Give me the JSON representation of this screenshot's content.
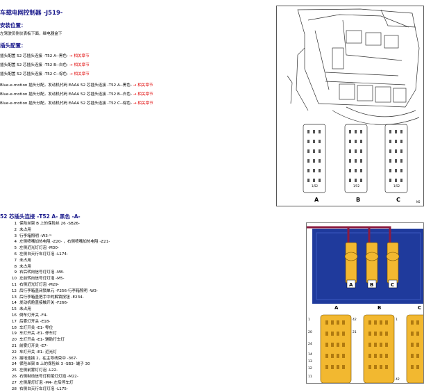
{
  "title": "车载电网控制器 -J519-",
  "install": {
    "heading": "安装位置：",
    "text": "左驾驶员侧仪表板下面，继电器盒下"
  },
  "plug": {
    "heading": "插头配置：",
    "rows": [
      {
        "text": "插头配置 52 芯插头连接 -T52 A--黑色-",
        "link": "→ 相关章节"
      },
      {
        "text": "插头配置 52 芯插头连接 -T52 B--白色-",
        "link": "→ 相关章节"
      },
      {
        "text": "插头配置 52 芯插头连接 -T52 C--棕色-",
        "link": "→ 相关章节"
      },
      {
        "text": "Blue-e-motion 插头分配，发动机代码 EAAA 52 芯插头连接 -T52 A--黑色-",
        "link": "→ 相关章节"
      },
      {
        "text": "Blue-e-motion 插头分配，发动机代码 EAAA 52 芯插头连接 -T52 B--白色-",
        "link": "→ 相关章节"
      },
      {
        "text": "Blue-e-motion 插头分配，发动机代码 EAAA 52 芯插头连接 -T52 C--棕色-",
        "link": "→ 相关章节"
      }
    ]
  },
  "section2": {
    "heading": "52 芯插头连接 -T52 A- 黑色 -A-",
    "pins": [
      {
        "num": "1",
        "text": "保险丝架 B 上的保险丝 26 -SB26-"
      },
      {
        "num": "2",
        "text": "未占用"
      },
      {
        "num": "3",
        "text": "行李箱照明 -W3-¹⁾"
      },
      {
        "num": "4",
        "text": "左侧喷嘴加热电阻 -Z20- ，右侧喷嘴加热电阻 -Z21-"
      },
      {
        "num": "5",
        "text": "左侧近光灯灯泡 -M30-"
      },
      {
        "num": "6",
        "text": "左侧白天行车灯灯泡 -L174-"
      },
      {
        "num": "7",
        "text": "未占用"
      },
      {
        "num": "8",
        "text": "未占用"
      },
      {
        "num": "9",
        "text": "右后转向信号灯灯泡 -M8-"
      },
      {
        "num": "10",
        "text": "左前转向信号灯灯泡 -M5-"
      },
      {
        "num": "11",
        "text": "右侧近光灯灯泡 -M29-"
      },
      {
        "num": "12",
        "text": "后行李箱盖闭锁单元 -F256-行李箱照明 -W3-"
      },
      {
        "num": "13",
        "text": "后行李箱盖把手中的解锁按钮 -E234-"
      },
      {
        "num": "14",
        "text": "发动机舱盖接触开关 -F266-"
      },
      {
        "num": "15",
        "text": "未占用"
      },
      {
        "num": "16",
        "text": "倒车灯开关 -F4-"
      },
      {
        "num": "17",
        "text": "后雾灯开关 -E18-"
      },
      {
        "num": "18",
        "text": "车灯开关 -E1- 零位"
      },
      {
        "num": "19",
        "text": "车灯开关 -E1- 停车灯"
      },
      {
        "num": "20",
        "text": "车灯开关 -E1- 辅助行车灯"
      },
      {
        "num": "21",
        "text": "前雾灯开关 -E7-"
      },
      {
        "num": "22",
        "text": "车灯开关 -E1- 近光灯"
      },
      {
        "num": "23",
        "text": "接地连接 2，在主导线束中 -367-"
      },
      {
        "num": "24",
        "text": "保险丝架 B 上的保险丝 3 -SB3- 端子 30"
      },
      {
        "num": "25",
        "text": "左侧前雾灯灯泡 -L22-"
      },
      {
        "num": "26",
        "text": "右侧制动信号灯和尾灯灯泡 -M22-"
      },
      {
        "num": "27",
        "text": "左侧尾灯灯泡 -M4- 左后停车灯"
      },
      {
        "num": "28",
        "text": "右侧白天行车灯灯泡 -L175-"
      }
    ]
  },
  "diagram_top": {
    "labels": [
      "A",
      "B",
      "C"
    ],
    "pin_labels": [
      "1/52",
      "1/52",
      "1/52"
    ],
    "ref": "N5"
  },
  "diagram_bottom": {
    "labels": [
      "A",
      "B",
      "C"
    ],
    "connector_labels": [
      "A",
      "B",
      "C"
    ],
    "pin_numbers": [
      "42",
      "1",
      "20",
      "21",
      "24",
      "14",
      "13",
      "12",
      "11",
      "1",
      "42"
    ]
  },
  "colors": {
    "heading": "#1a1a8c",
    "link": "#e00000",
    "panel_blue": "#1f3a9c",
    "connector_yellow": "#f2b830",
    "wire": "#8c1c40"
  }
}
